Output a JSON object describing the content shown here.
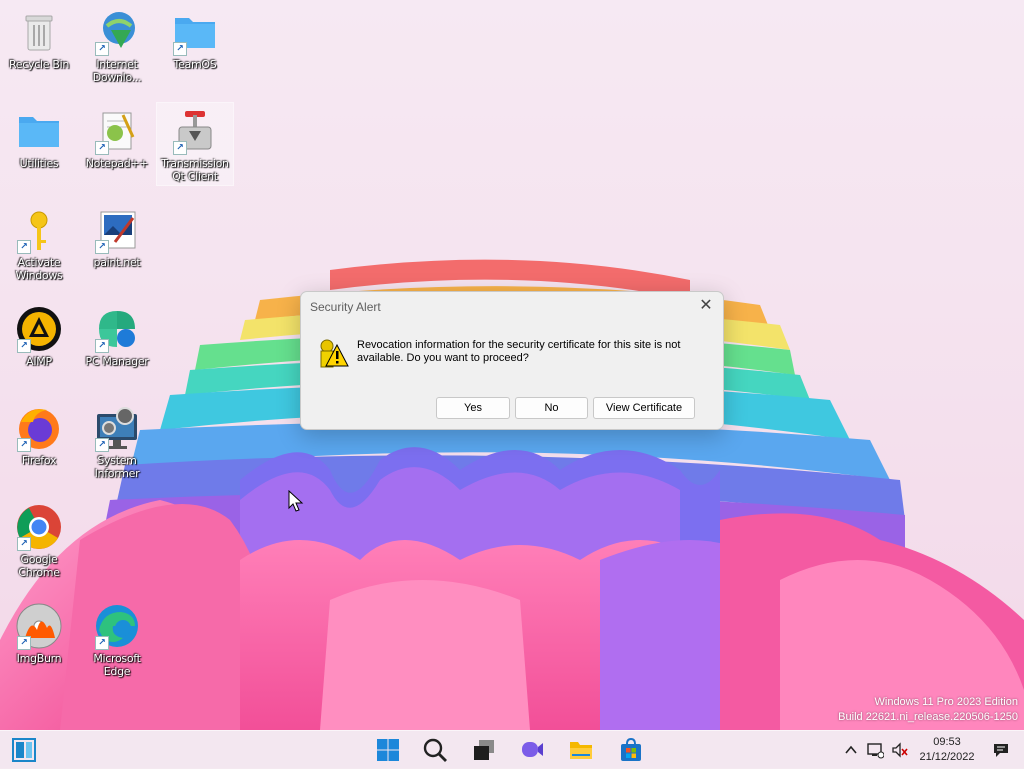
{
  "desktop": {
    "icons": [
      {
        "label": "Recycle Bin",
        "icon": "recycle-bin-icon"
      },
      {
        "label": "Internet Downlo...",
        "icon": "internet-download-manager-icon"
      },
      {
        "label": "TeamOS",
        "icon": "folder-icon"
      },
      {
        "label": "Utilities",
        "icon": "folder-icon"
      },
      {
        "label": "Notepad++",
        "icon": "notepad-plus-plus-icon"
      },
      {
        "label": "Transmission Qt Client",
        "icon": "transmission-icon"
      },
      {
        "label": "Activate Windows",
        "icon": "key-icon"
      },
      {
        "label": "paint.net",
        "icon": "paint-net-icon"
      },
      {
        "label": "AIMP",
        "icon": "aimp-icon"
      },
      {
        "label": "PC Manager",
        "icon": "pc-manager-icon"
      },
      {
        "label": "Firefox",
        "icon": "firefox-icon"
      },
      {
        "label": "System Informer",
        "icon": "system-informer-icon"
      },
      {
        "label": "Google Chrome",
        "icon": "chrome-icon"
      },
      {
        "label": "ImgBurn",
        "icon": "imgburn-icon"
      },
      {
        "label": "Microsoft Edge",
        "icon": "edge-icon"
      }
    ]
  },
  "dialog": {
    "title": "Security Alert",
    "message": "Revocation information for the security certificate for this site is not available. Do you want to proceed?",
    "buttons": {
      "yes": "Yes",
      "no": "No",
      "view_certificate": "View Certificate"
    },
    "close_icon": "close-icon"
  },
  "watermark": {
    "line1": "Windows 11 Pro 2023 Edition",
    "line2": "Build 22621.ni_release.220506-1250"
  },
  "taskbar": {
    "items": [
      "widgets-icon",
      "start-icon",
      "search-icon",
      "task-view-icon",
      "chat-icon",
      "file-explorer-icon",
      "store-icon"
    ],
    "tray": [
      "chevron-up-icon",
      "network-icon",
      "volume-muted-icon",
      "notifications-icon"
    ],
    "time": "09:53",
    "date": "21/12/2022"
  },
  "colors": {
    "accent": "#0078d4",
    "taskbar_bg": "#f3e8f0"
  }
}
